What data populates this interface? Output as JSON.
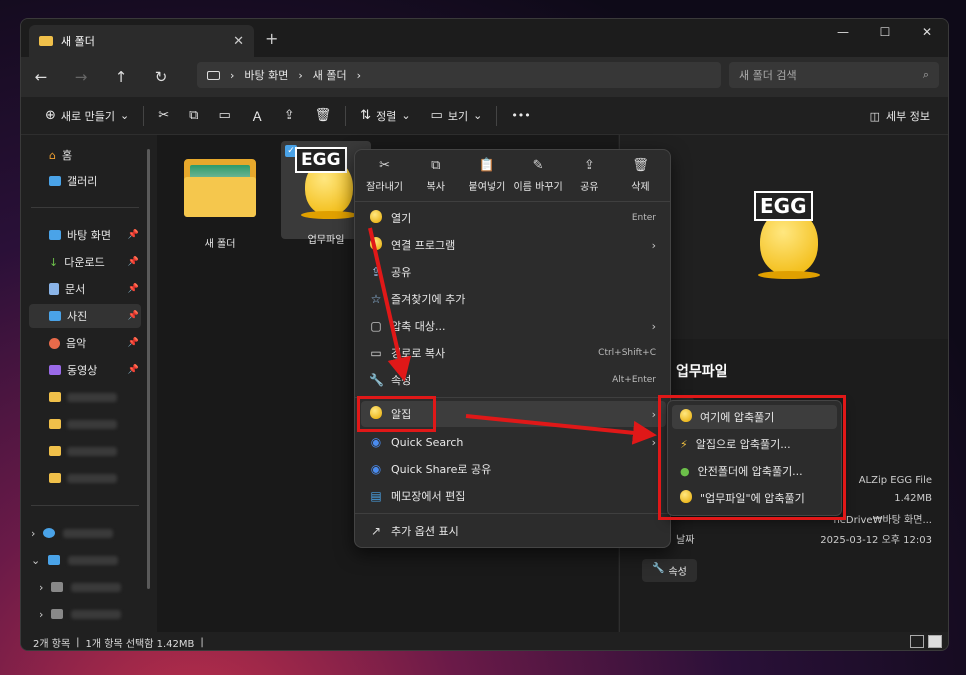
{
  "window": {
    "tab_title": "새 폴더",
    "tab_close": "✕",
    "new_tab": "+",
    "controls": [
      "—",
      "☐",
      "✕"
    ]
  },
  "address_bar": {
    "back": "←",
    "forward": "→",
    "up": "↑",
    "refresh": "↻",
    "path": [
      "바탕 화면",
      "새 폴더"
    ],
    "separator": "›",
    "search_placeholder": "새 폴더 검색"
  },
  "toolbar": {
    "new_label": "새로 만들기",
    "sort_label": "정렬",
    "view_label": "보기",
    "more": "•••",
    "details_label": "세부 정보"
  },
  "sidebar": {
    "home": "홈",
    "gallery": "갤러리",
    "pinned": [
      {
        "label": "바탕 화면",
        "color": "#4aa3e8"
      },
      {
        "label": "다운로드",
        "color": "#6cc04a"
      },
      {
        "label": "문서",
        "color": "#8ab4e8"
      },
      {
        "label": "사진",
        "color": "#4aa3e8"
      },
      {
        "label": "음악",
        "color": "#e86a4a"
      },
      {
        "label": "동영상",
        "color": "#9a6ae8"
      }
    ],
    "pin_glyph": "📌"
  },
  "files": [
    {
      "name": "새 폴더",
      "type": "folder"
    },
    {
      "name": "업무파일",
      "type": "egg",
      "badge": "EGG",
      "selected": true
    }
  ],
  "context_menu": {
    "quick_actions": [
      {
        "icon": "cut-icon",
        "glyph": "✂",
        "label": "잘라내기"
      },
      {
        "icon": "copy-icon",
        "glyph": "⧉",
        "label": "복사"
      },
      {
        "icon": "paste-icon",
        "glyph": "📋",
        "label": "붙여넣기"
      },
      {
        "icon": "rename-icon",
        "glyph": "✎",
        "label": "이름 바꾸기"
      },
      {
        "icon": "share-icon",
        "glyph": "⇪",
        "label": "공유"
      },
      {
        "icon": "delete-icon",
        "glyph": "🗑",
        "label": "삭제"
      }
    ],
    "items": [
      {
        "label": "열기",
        "shortcut": "Enter"
      },
      {
        "label": "연결 프로그램",
        "submenu": "›"
      },
      {
        "label": "공유"
      },
      {
        "label": "즐겨찾기에 추가"
      },
      {
        "label": "압축 대상...",
        "submenu": "›"
      },
      {
        "label": "경로로 복사",
        "shortcut": "Ctrl+Shift+C"
      },
      {
        "label": "속성",
        "shortcut": "Alt+Enter"
      },
      {
        "label": "알집",
        "submenu": "›"
      },
      {
        "label": "Quick Search",
        "submenu": "›"
      },
      {
        "label": "Quick Share로 공유"
      },
      {
        "label": "메모장에서 편집"
      },
      {
        "label": "추가 옵션 표시"
      }
    ]
  },
  "submenu": [
    "여기에 압축풀기",
    "알집으로 압축풀기...",
    "안전폴더에 압축풀기...",
    "\"업무파일\"에 압축풀기"
  ],
  "details_pane": {
    "badge": "EGG",
    "title": "업무파일",
    "share": "공유",
    "type_value": "ALZip EGG File",
    "size_value": "1.42MB",
    "location_value": "neDrive₩바탕 화면...",
    "modified_label": "날짜",
    "modified_value": "2025-03-12 오후 12:03",
    "properties": "속성"
  },
  "status": {
    "count": "2개 항목",
    "selection": "1개 항목 선택함 1.42MB"
  },
  "annotation_color": "#e01818"
}
